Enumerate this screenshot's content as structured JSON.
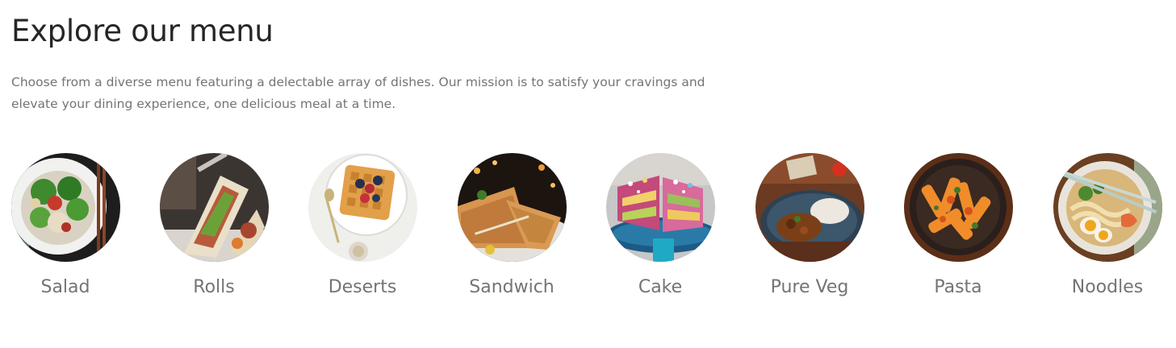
{
  "header": {
    "title": "Explore our menu",
    "description": "Choose from a diverse menu featuring a delectable array of dishes. Our mission is to satisfy your cravings and elevate your dining experience, one delicious meal at a time."
  },
  "menu": {
    "items": [
      {
        "label": "Salad",
        "icon": "salad-image"
      },
      {
        "label": "Rolls",
        "icon": "rolls-image"
      },
      {
        "label": "Deserts",
        "icon": "deserts-image"
      },
      {
        "label": "Sandwich",
        "icon": "sandwich-image"
      },
      {
        "label": "Cake",
        "icon": "cake-image"
      },
      {
        "label": "Pure Veg",
        "icon": "pure-veg-image"
      },
      {
        "label": "Pasta",
        "icon": "pasta-image"
      },
      {
        "label": "Noodles",
        "icon": "noodles-image"
      }
    ]
  }
}
